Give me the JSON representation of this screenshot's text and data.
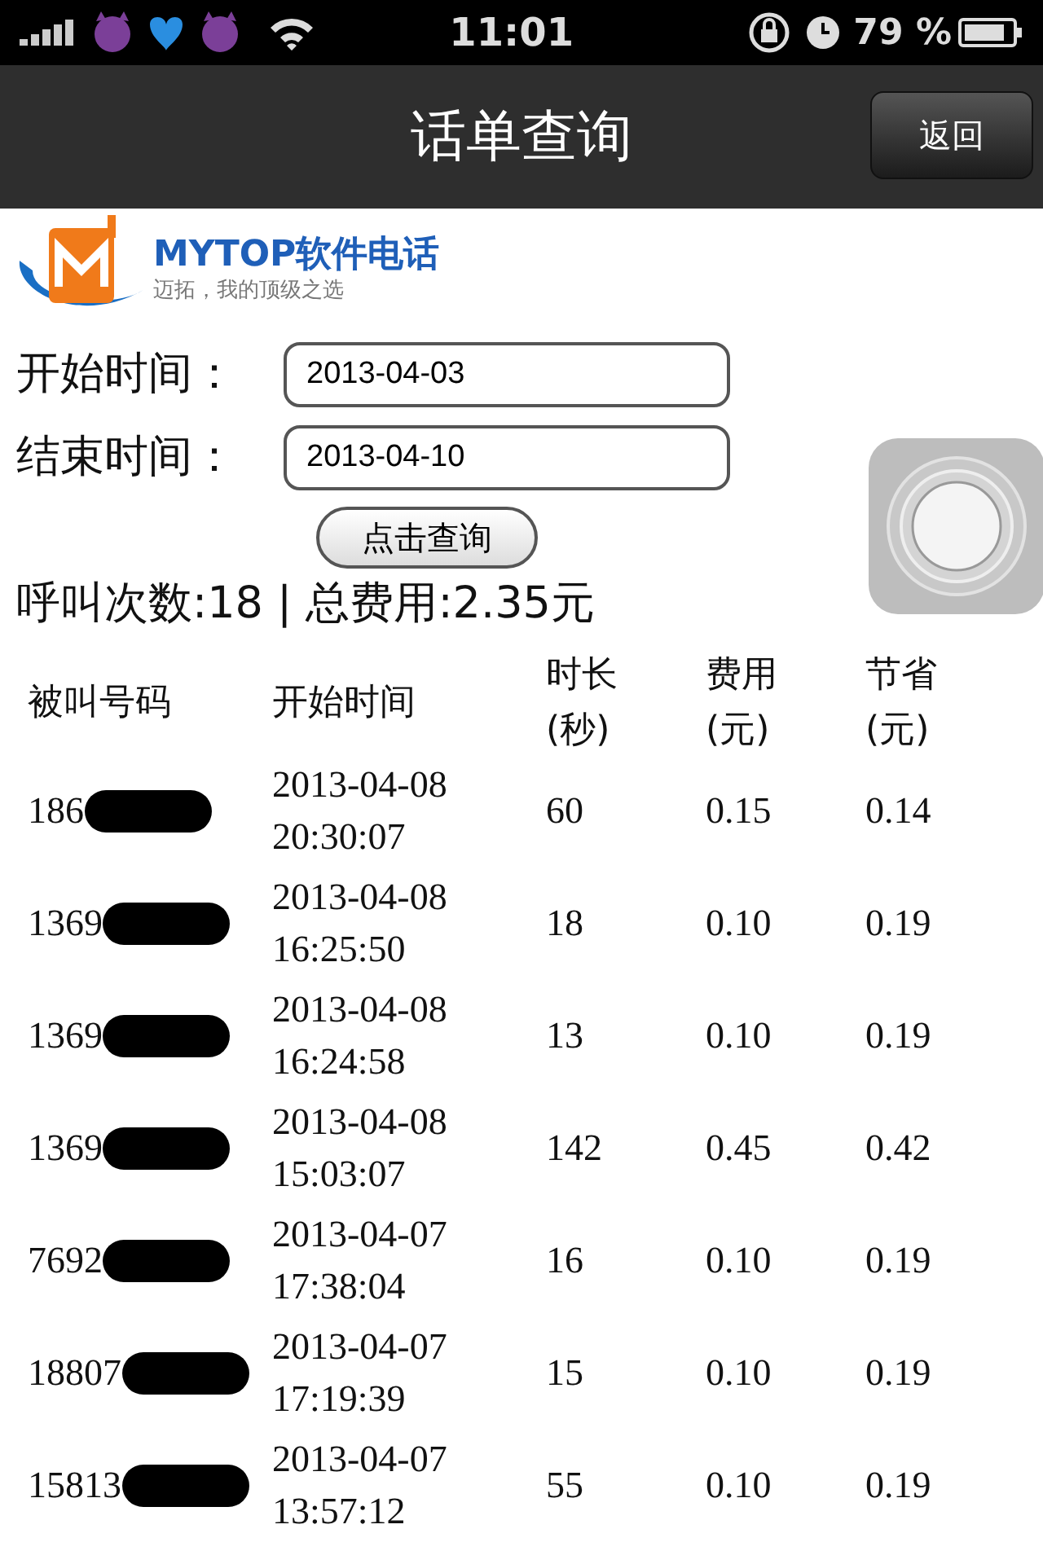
{
  "status_bar": {
    "time": "11:01",
    "battery": "79 %"
  },
  "nav": {
    "title": "话单查询",
    "back": "返回"
  },
  "logo": {
    "brand": "MYTOP软件电话",
    "slogan": "迈拓，我的顶级之选"
  },
  "form": {
    "fields": [
      {
        "label": "开始时间：",
        "value": "2013-04-03"
      },
      {
        "label": "结束时间：",
        "value": "2013-04-10"
      }
    ],
    "button": "点击查询"
  },
  "summary": "呼叫次数:18 | 总费用:2.35元",
  "table": {
    "columns": [
      "被叫号码",
      "开始时间",
      "时长\n(秒)",
      "费用\n(元)",
      "节省\n(元)"
    ],
    "rows": [
      {
        "number": "186",
        "date": "2013-04-08",
        "time": "20:30:07",
        "duration": "60",
        "cost": "0.15",
        "saved": "0.14"
      },
      {
        "number": "1369",
        "date": "2013-04-08",
        "time": "16:25:50",
        "duration": "18",
        "cost": "0.10",
        "saved": "0.19"
      },
      {
        "number": "1369",
        "date": "2013-04-08",
        "time": "16:24:58",
        "duration": "13",
        "cost": "0.10",
        "saved": "0.19"
      },
      {
        "number": "1369",
        "date": "2013-04-08",
        "time": "15:03:07",
        "duration": "142",
        "cost": "0.45",
        "saved": "0.42"
      },
      {
        "number": "7692",
        "date": "2013-04-07",
        "time": "17:38:04",
        "duration": "16",
        "cost": "0.10",
        "saved": "0.19"
      },
      {
        "number": "18807",
        "date": "2013-04-07",
        "time": "17:19:39",
        "duration": "15",
        "cost": "0.10",
        "saved": "0.19"
      },
      {
        "number": "15813",
        "date": "2013-04-07",
        "time": "13:57:12",
        "duration": "55",
        "cost": "0.10",
        "saved": "0.19"
      }
    ]
  }
}
